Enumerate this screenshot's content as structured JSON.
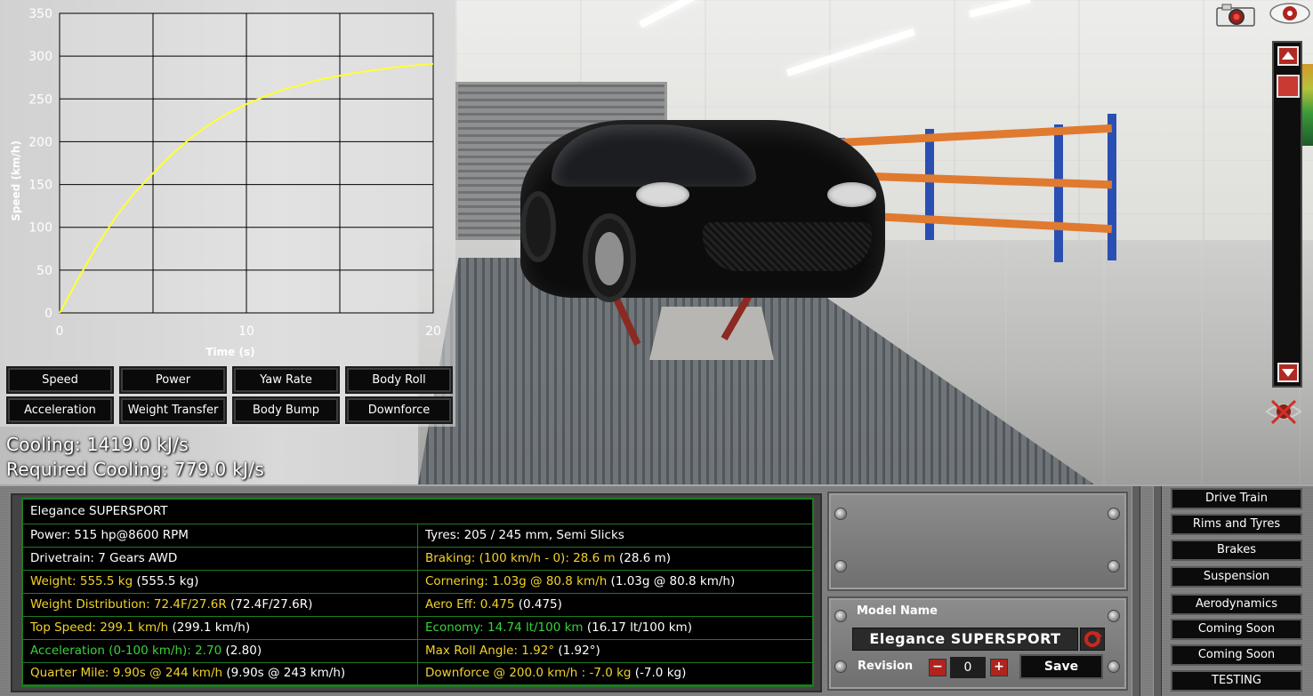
{
  "graph": {
    "chart_data": {
      "type": "line",
      "xlabel": "Time (s)",
      "ylabel": "Speed (km/h)",
      "xlim": [
        0,
        20
      ],
      "ylim": [
        0,
        350
      ],
      "x_ticks": [
        "0",
        "10",
        "20"
      ],
      "y_ticks": [
        "0",
        "50",
        "100",
        "150",
        "200",
        "250",
        "300",
        "350"
      ],
      "grid": true,
      "series": [
        {
          "color": "#ffff33",
          "x": [
            0,
            1,
            2,
            3,
            4,
            5,
            6,
            7,
            8,
            9,
            10,
            11,
            12,
            13,
            14,
            15,
            16,
            17,
            18,
            19,
            20
          ],
          "y": [
            0,
            40,
            78,
            112,
            140,
            163,
            185,
            204,
            220,
            233,
            244,
            253,
            261,
            267,
            273,
            277,
            281,
            284,
            287,
            289,
            291
          ]
        }
      ]
    },
    "buttons": [
      "Speed",
      "Power",
      "Yaw Rate",
      "Body Roll",
      "Acceleration",
      "Weight Transfer",
      "Body Bump",
      "Downforce"
    ]
  },
  "cooling": {
    "cooling": "Cooling: 1419.0 kJ/s",
    "required": "Required Cooling: 779.0 kJ/s"
  },
  "stats": {
    "title": "Elegance SUPERSPORT",
    "rows": [
      {
        "left": {
          "main": "Power: 515 hp@8600 RPM",
          "extra": "",
          "color": "w"
        },
        "right": {
          "main": "Tyres: 205 / 245 mm, Semi Slicks",
          "extra": "",
          "color": "w"
        }
      },
      {
        "left": {
          "main": "Drivetrain: 7 Gears AWD",
          "extra": "",
          "color": "w"
        },
        "right": {
          "main": "Braking: (100 km/h - 0): 28.6 m",
          "extra": " (28.6 m)",
          "color": "y"
        }
      },
      {
        "left": {
          "main": "Weight: 555.5 kg",
          "extra": " (555.5 kg)",
          "color": "y"
        },
        "right": {
          "main": "Cornering: 1.03g @ 80.8 km/h",
          "extra": " (1.03g @ 80.8 km/h)",
          "color": "y"
        }
      },
      {
        "left": {
          "main": "Weight Distribution: 72.4F/27.6R",
          "extra": " (72.4F/27.6R)",
          "color": "y"
        },
        "right": {
          "main": "Aero Eff: 0.475",
          "extra": " (0.475)",
          "color": "y"
        }
      },
      {
        "left": {
          "main": "Top Speed: 299.1 km/h",
          "extra": " (299.1 km/h)",
          "color": "y"
        },
        "right": {
          "main": "Economy: 14.74 lt/100 km",
          "extra": " (16.17 lt/100 km)",
          "color": "g"
        }
      },
      {
        "left": {
          "main": "Acceleration (0-100 km/h): 2.70",
          "extra": " (2.80)",
          "color": "g"
        },
        "right": {
          "main": "Max Roll Angle: 1.92°",
          "extra": " (1.92°)",
          "color": "y"
        }
      },
      {
        "left": {
          "main": "Quarter Mile: 9.90s @ 244 km/h",
          "extra": " (9.90s @ 243 km/h)",
          "color": "y"
        },
        "right": {
          "main": "Downforce @ 200.0 km/h : -7.0 kg",
          "extra": " (-7.0 kg)",
          "color": "y"
        }
      }
    ]
  },
  "model": {
    "name_label": "Model Name",
    "name_value": "Elegance SUPERSPORT",
    "revision_label": "Revision",
    "revision_value": "0",
    "minus": "−",
    "plus": "+",
    "save": "Save"
  },
  "menu": [
    "Drive Train",
    "Rims and Tyres",
    "Brakes",
    "Suspension",
    "Aerodynamics",
    "Coming Soon",
    "Coming Soon",
    "TESTING"
  ],
  "icons": {
    "camera": "camera-icon",
    "eye": "eye-icon",
    "scroll_up": "arrow-up-icon",
    "scroll_down": "arrow-down-icon",
    "reset_view": "reset-view-icon",
    "model_reset": "reset-icon"
  },
  "colors": {
    "accent_red": "#b02a23",
    "stat_yellow": "#f0d22a",
    "stat_green": "#3bd13b",
    "grid_border": "#1f7a23"
  }
}
